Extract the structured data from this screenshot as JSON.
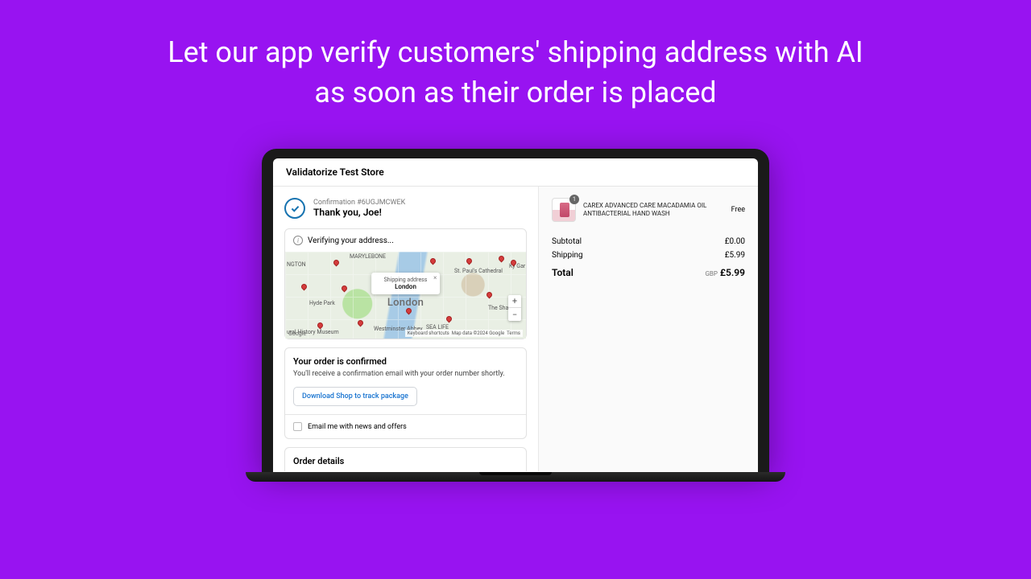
{
  "headline": "Let our app verify customers' shipping address with AI as soon as their order is placed",
  "store": {
    "name": "Validatorize Test Store"
  },
  "confirmation": {
    "ref_label": "Confirmation #6UGJMCWEK",
    "thank_you": "Thank you, Joe!"
  },
  "verify_bar": {
    "text": "Verifying your address..."
  },
  "map": {
    "popup_title": "Shipping address",
    "popup_city": "London",
    "city_label": "London",
    "areas": {
      "marylebone": "MARYLEBONE",
      "hyde_park": "Hyde Park",
      "st_pauls": "St. Paul's Cathedral",
      "the_shard": "The Shard",
      "westminster": "Westminster Abbey",
      "sea_life": "SEA LIFE",
      "history_museum": "ural History Museum",
      "ngton": "NGTON",
      "ky_gar": "Ky Gar"
    },
    "attr": {
      "shortcuts": "Keyboard shortcuts",
      "mapdata": "Map data ©2024 Google",
      "terms": "Terms"
    },
    "google": "Google"
  },
  "confirmed": {
    "heading": "Your order is confirmed",
    "desc": "You'll receive a confirmation email with your order number shortly.",
    "download_btn": "Download Shop to track package",
    "email_label": "Email me with news and offers"
  },
  "order_details": {
    "heading": "Order details"
  },
  "cart": {
    "item": {
      "qty": "1",
      "name": "CAREX ADVANCED CARE MACADAMIA OIL ANTIBACTERIAL HAND WASH",
      "price": "Free"
    },
    "subtotal_label": "Subtotal",
    "subtotal_value": "£0.00",
    "shipping_label": "Shipping",
    "shipping_value": "£5.99",
    "total_label": "Total",
    "currency": "GBP",
    "total_value": "£5.99"
  }
}
